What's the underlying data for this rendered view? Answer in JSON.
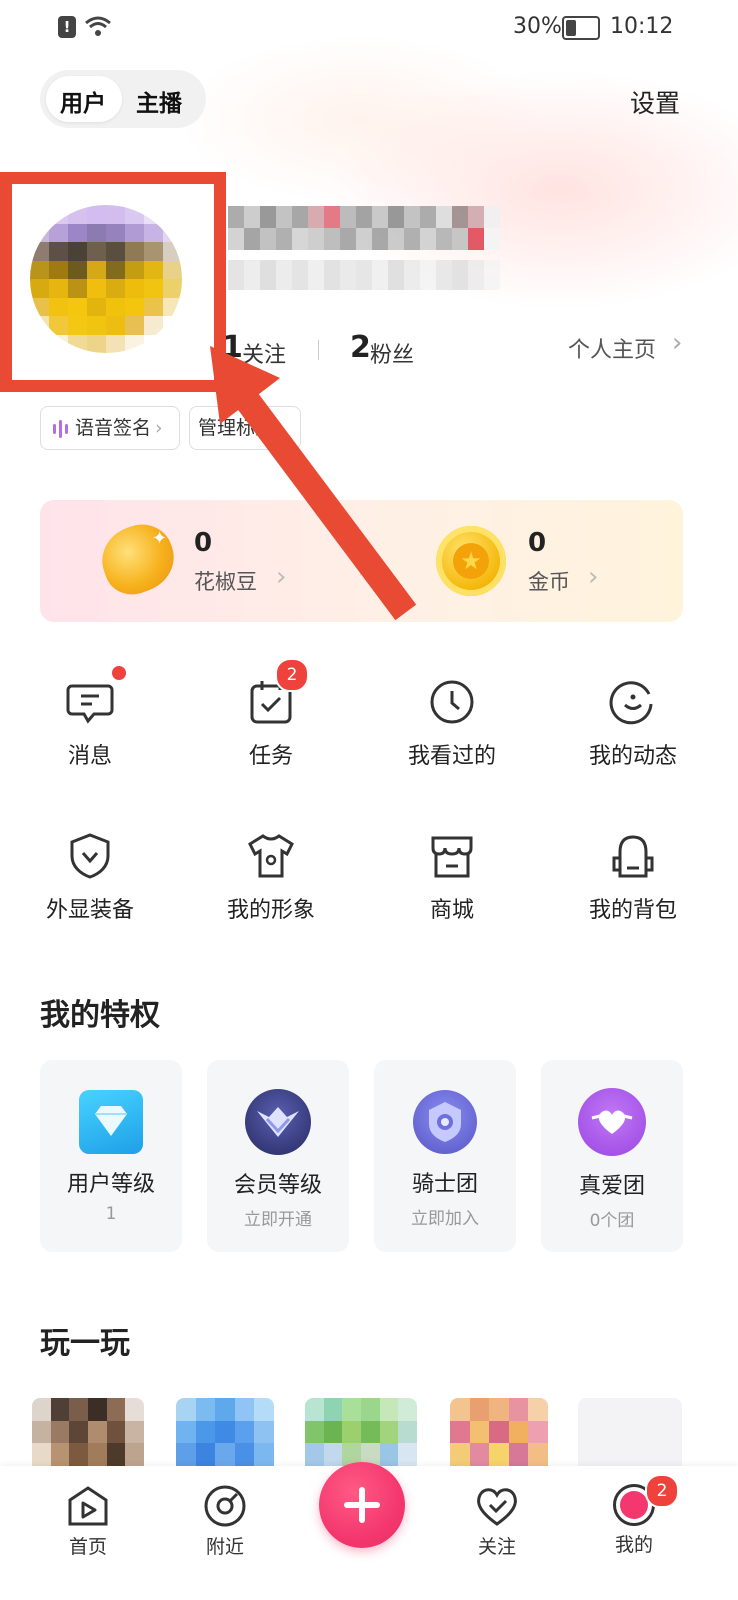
{
  "status_bar": {
    "battery": "30%",
    "time": "10:12"
  },
  "header": {
    "tabs": [
      "用户",
      "主播"
    ],
    "settings_label": "设置"
  },
  "profile": {
    "following_count": "1",
    "following_label": "关注",
    "fans_count": "2",
    "fans_label": "粉丝",
    "homepage_link": "个人主页",
    "chips": [
      "语音签名",
      "管理标签"
    ]
  },
  "wallet": [
    {
      "value": "0",
      "label": "花椒豆",
      "icon": "bean-icon"
    },
    {
      "value": "0",
      "label": "金币",
      "icon": "gold-coin-icon"
    }
  ],
  "menu": [
    {
      "label": "消息",
      "icon": "message-icon",
      "red_dot": true
    },
    {
      "label": "任务",
      "icon": "task-icon",
      "badge": "2"
    },
    {
      "label": "我看过的",
      "icon": "clock-icon"
    },
    {
      "label": "我的动态",
      "icon": "moments-icon"
    },
    {
      "label": "外显装备",
      "icon": "shield-icon"
    },
    {
      "label": "我的形象",
      "icon": "tshirt-icon"
    },
    {
      "label": "商城",
      "icon": "store-icon"
    },
    {
      "label": "我的背包",
      "icon": "backpack-icon"
    }
  ],
  "privileges": {
    "title": "我的特权",
    "cards": [
      {
        "title": "用户等级",
        "sub": "1",
        "icon": "diamond-icon",
        "color": "#2fb6f0"
      },
      {
        "title": "会员等级",
        "sub": "立即开通",
        "icon": "vip-crest-icon",
        "color": "#3b3f86"
      },
      {
        "title": "骑士团",
        "sub": "立即加入",
        "icon": "knight-badge-icon",
        "color": "#6f6fd8"
      },
      {
        "title": "真爱团",
        "sub": "0个团",
        "icon": "heart-badge-icon",
        "color": "#a857e8"
      }
    ]
  },
  "play": {
    "title": "玩一玩"
  },
  "bottom_nav": [
    {
      "label": "首页",
      "icon": "home-play-icon"
    },
    {
      "label": "附近",
      "icon": "nearby-icon"
    },
    {
      "label": "",
      "icon": "plus-icon"
    },
    {
      "label": "关注",
      "icon": "heart-check-icon"
    },
    {
      "label": "我的",
      "icon": "mine-avatar-icon",
      "badge": "2"
    }
  ],
  "colors": {
    "accent": "#f0423d",
    "annotation": "#e84a33",
    "create_button": "#f4386f"
  }
}
